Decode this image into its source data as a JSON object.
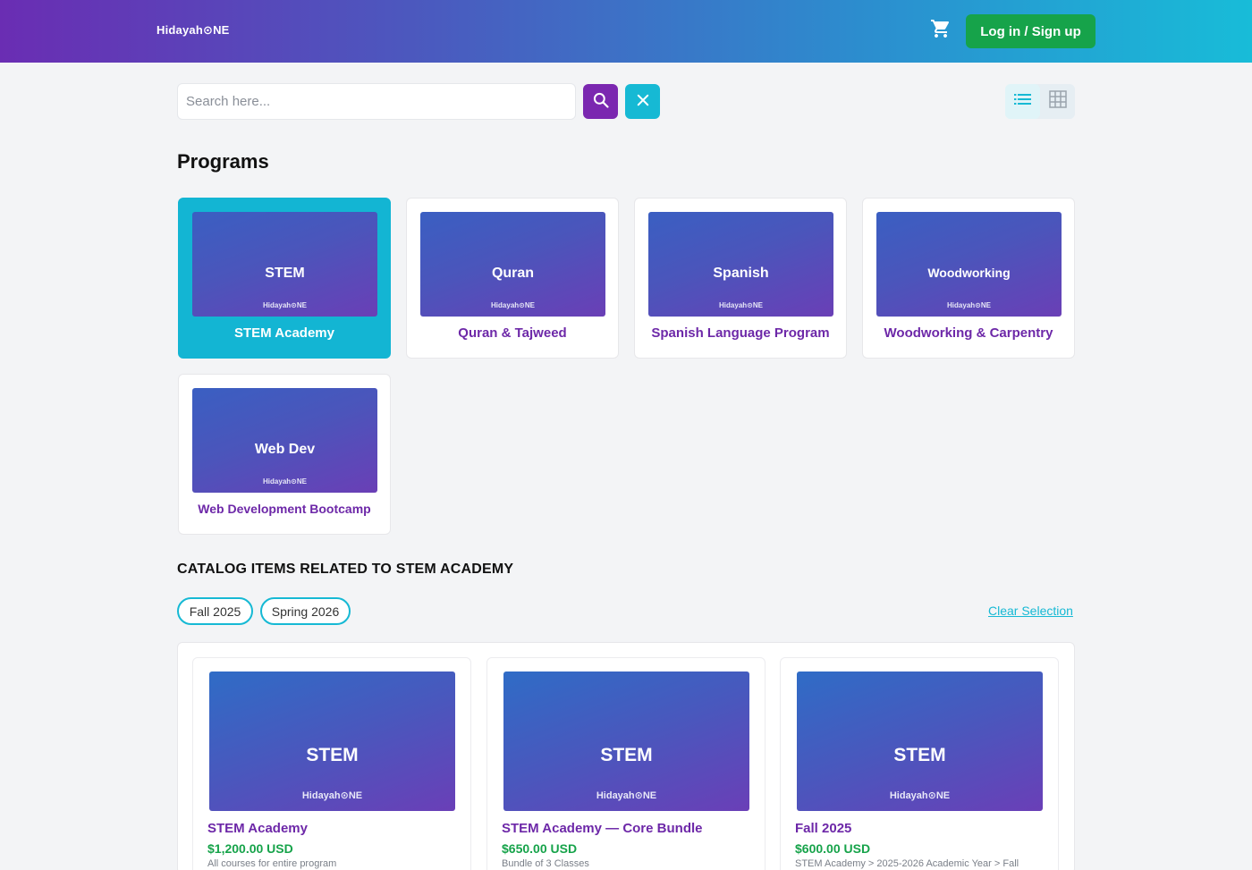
{
  "header": {
    "logo": "Hidayah⊙NE",
    "cart_icon": "cart-icon",
    "login_label": "Log in / Sign up",
    "gradient_colors": [
      "#6a2db3",
      "#18bcd8"
    ]
  },
  "search": {
    "placeholder": "Search here...",
    "value": "",
    "search_icon": "search-icon",
    "clear_icon": "close-icon"
  },
  "view_toggle": {
    "list_icon": "list-icon",
    "grid_icon": "grid-icon",
    "active": "list"
  },
  "programs": {
    "title": "Programs",
    "items": [
      {
        "thumb": "STEM",
        "brand": "Hidayah⊙NE",
        "title": "STEM Academy",
        "selected": true
      },
      {
        "thumb": "Quran",
        "brand": "Hidayah⊙NE",
        "title": "Quran & Tajweed",
        "selected": false
      },
      {
        "thumb": "Spanish",
        "brand": "Hidayah⊙NE",
        "title": "Spanish Language Program",
        "selected": false
      },
      {
        "thumb": "Woodworking",
        "brand": "Hidayah⊙NE",
        "title": "Woodworking & Carpentry",
        "selected": false
      },
      {
        "thumb": "Web Dev",
        "brand": "Hidayah⊙NE",
        "title": "Web Development Bootcamp",
        "selected": false
      }
    ]
  },
  "catalog": {
    "heading": "CATALOG ITEMS RELATED TO STEM ACADEMY",
    "chips": [
      "Fall 2025",
      "Spring 2026"
    ],
    "clear_selection": "Clear Selection",
    "items": [
      {
        "thumb": "STEM",
        "brand": "Hidayah⊙NE",
        "title": "STEM Academy",
        "price": "$1,200.00 USD",
        "subtitle": "All courses for entire program"
      },
      {
        "thumb": "STEM",
        "brand": "Hidayah⊙NE",
        "title": "STEM Academy — Core Bundle",
        "price": "$650.00 USD",
        "subtitle": "Bundle of 3 Classes"
      },
      {
        "thumb": "STEM",
        "brand": "Hidayah⊙NE",
        "title": "Fall 2025",
        "price": "$600.00 USD",
        "subtitle": "STEM Academy > 2025-2026 Academic Year > Fall"
      }
    ]
  },
  "colors": {
    "accent_purple": "#7b27b0",
    "accent_cyan": "#16b9d4",
    "price_green": "#16a34a",
    "title_purple": "#6d28a8"
  }
}
